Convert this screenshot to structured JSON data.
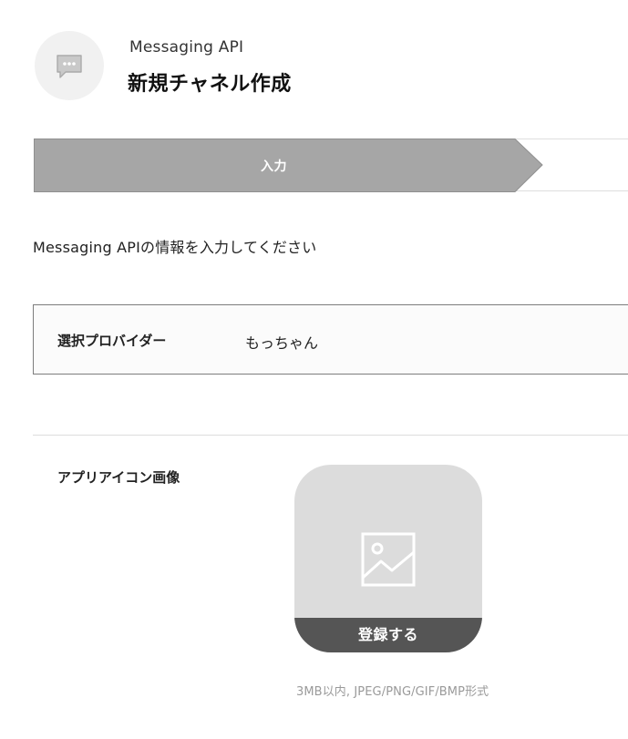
{
  "header": {
    "subtitle": "Messaging API",
    "title": "新規チャネル作成",
    "icon": "chat-bubble-icon"
  },
  "stepper": {
    "active_step_label": "入力"
  },
  "instruction": "Messaging APIの情報を入力してください",
  "provider": {
    "label": "選択プロバイダー",
    "value": "もっちゃん"
  },
  "app_icon": {
    "label": "アプリアイコン画像",
    "placeholder_icon": "image-icon",
    "register_label": "登録する",
    "hint": "3MB以内, JPEG/PNG/GIF/BMP形式"
  },
  "colors": {
    "step_active_fill": "#a6a6a6",
    "register_bar": "#555555",
    "uploader_bg": "#dcdcdc"
  }
}
